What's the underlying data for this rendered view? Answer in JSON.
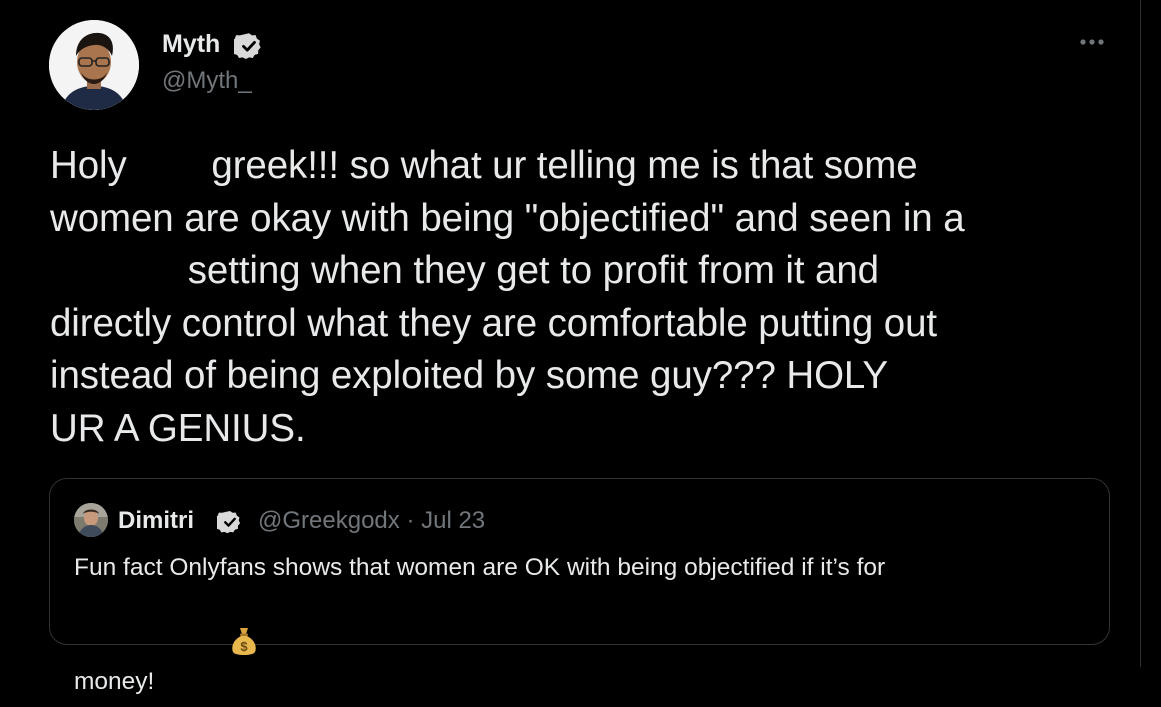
{
  "tweet": {
    "author": {
      "name": "Myth",
      "handle": "@Myth_",
      "verified": true,
      "avatar_icon": "profile-photo"
    },
    "more_icon": "more-horizontal-icon",
    "text_lines": [
      "Holy        greek!!! so what ur telling me is that some",
      "women are okay with being \"objectified\" and seen in a",
      "             setting when they get to profit from it and",
      "directly control what they are comfortable putting out",
      "instead of being exploited by some guy??? HOLY",
      "UR A GENIUS."
    ]
  },
  "quoted_tweet": {
    "author": {
      "name": "Dimitri",
      "handle": "@Greekgodx",
      "verified": true,
      "avatar_icon": "profile-photo"
    },
    "separator": "·",
    "date": "Jul 23",
    "text_lines": [
      "Fun fact Onlyfans shows that women are OK with being objectified if it’s for",
      "money! "
    ],
    "emoji": "money-bag-icon"
  },
  "colors": {
    "background": "#000000",
    "text": "#e7e9ea",
    "secondary_text": "#71767b",
    "border": "#2f3336",
    "verified_badge": "#d9d9d9"
  }
}
